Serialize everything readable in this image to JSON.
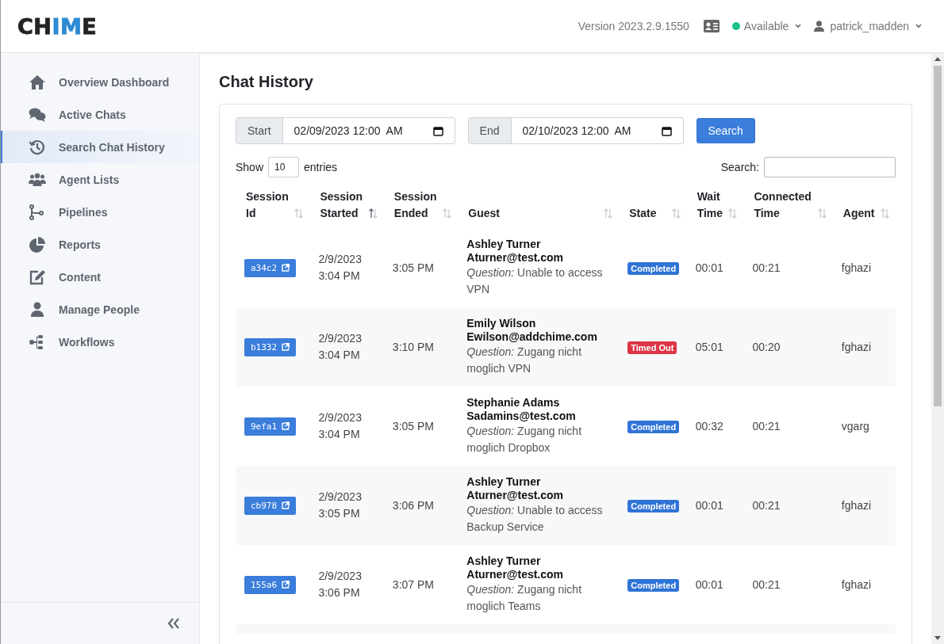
{
  "header": {
    "logo": [
      {
        "text": "CH",
        "accent": false
      },
      {
        "text": "IM",
        "accent": true
      },
      {
        "text": "E",
        "accent": false
      }
    ],
    "version": "Version 2023.2.9.1550",
    "status": {
      "label": "Available",
      "color": "#1fbf8a"
    },
    "user": "patrick_madden"
  },
  "sidebar": {
    "items": [
      {
        "label": "Overview Dashboard",
        "selected": false
      },
      {
        "label": "Active Chats",
        "selected": false
      },
      {
        "label": "Search Chat History",
        "selected": true
      },
      {
        "label": "Agent Lists",
        "selected": false
      },
      {
        "label": "Pipelines",
        "selected": false
      },
      {
        "label": "Reports",
        "selected": false
      },
      {
        "label": "Content",
        "selected": false
      },
      {
        "label": "Manage People",
        "selected": false
      },
      {
        "label": "Workflows",
        "selected": false
      }
    ]
  },
  "page_title": "Chat History",
  "filters": {
    "start_label": "Start",
    "start_value": "02/09/2023 12:00  AM",
    "end_label": "End",
    "end_value": "02/10/2023 12:00  AM",
    "search_button": "Search"
  },
  "length": {
    "show": "Show",
    "value": "10",
    "entries": "entries"
  },
  "table_search": {
    "label": "Search:"
  },
  "table": {
    "columns": [
      {
        "line1": "Session",
        "line2": "Id",
        "sorted": false
      },
      {
        "line1": "Session",
        "line2": "Started",
        "sorted": true
      },
      {
        "line1": "Session",
        "line2": "Ended",
        "sorted": false
      },
      {
        "line2": "Guest",
        "sorted": false
      },
      {
        "line2": "State",
        "sorted": false
      },
      {
        "line1": "Wait",
        "line2": "Time",
        "sorted": false
      },
      {
        "line1": "Connected",
        "line2": "Time",
        "sorted": false
      },
      {
        "line2": "Agent",
        "sorted": false
      }
    ],
    "rows": [
      {
        "id": "a34c2",
        "started": [
          "2/9/2023",
          "3:04 PM"
        ],
        "ended": "3:05 PM",
        "guest_name": "Ashley Turner",
        "guest_email": "Aturner@test.com",
        "question": "*Question:* Unable to access VPN",
        "state": {
          "label": "Completed",
          "color": "#2f74d6"
        },
        "wait": "00:01",
        "connected": "00:21",
        "agent": "fghazi"
      },
      {
        "id": "b1332",
        "started": [
          "2/9/2023",
          "3:04 PM"
        ],
        "ended": "3:10 PM",
        "guest_name": "Emily Wilson",
        "guest_email": "Ewilson@addchime.com",
        "question": "*Question:* Zugang nicht moglich VPN",
        "state": {
          "label": "Timed Out",
          "color": "#dc3545"
        },
        "wait": "05:01",
        "connected": "00:20",
        "agent": "fghazi"
      },
      {
        "id": "9efa1",
        "started": [
          "2/9/2023",
          "3:04 PM"
        ],
        "ended": "3:05 PM",
        "guest_name": "Stephanie Adams",
        "guest_email": "Sadamins@test.com",
        "question": "*Question:* Zugang nicht moglich Dropbox",
        "state": {
          "label": "Completed",
          "color": "#2f74d6"
        },
        "wait": "00:32",
        "connected": "00:21",
        "agent": "vgarg"
      },
      {
        "id": "cb978",
        "started": [
          "2/9/2023",
          "3:05 PM"
        ],
        "ended": "3:06 PM",
        "guest_name": "Ashley Turner",
        "guest_email": "Aturner@test.com",
        "question": "*Question:* Unable to access Backup Service",
        "state": {
          "label": "Completed",
          "color": "#2f74d6"
        },
        "wait": "00:01",
        "connected": "00:21",
        "agent": "fghazi"
      },
      {
        "id": "155a6",
        "started": [
          "2/9/2023",
          "3:06 PM"
        ],
        "ended": "3:07 PM",
        "guest_name": "Ashley Turner",
        "guest_email": "Aturner@test.com",
        "question": "*Question:* Zugang nicht moglich Teams",
        "state": {
          "label": "Completed",
          "color": "#2f74d6"
        },
        "wait": "00:01",
        "connected": "00:21",
        "agent": "fghazi"
      }
    ]
  }
}
